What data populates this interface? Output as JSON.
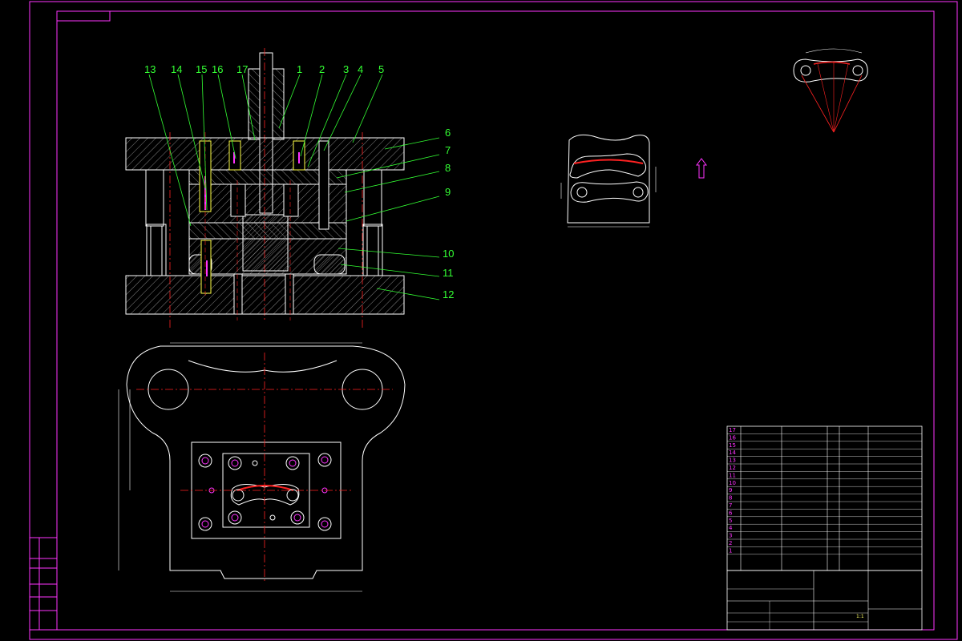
{
  "colors": {
    "background": "#000000",
    "frame": "#ff33ff",
    "outline": "#ffffff",
    "centerline": "#ff2222",
    "leader": "#33ff33",
    "hatch": "#cccccc",
    "dimension": "#ffffff",
    "bom_text": "#ff33ff",
    "bolt": "#ffff44"
  },
  "balloons": [
    "13",
    "14",
    "15",
    "16",
    "17",
    "1",
    "2",
    "3",
    "4",
    "5",
    "6",
    "7",
    "8",
    "9",
    "10",
    "11",
    "12"
  ],
  "side_labels": [
    "",
    "",
    "",
    "",
    "",
    ""
  ],
  "bom": {
    "rows": [
      {
        "no": "17",
        "name": "",
        "qty": "",
        "material": "",
        "note": ""
      },
      {
        "no": "16",
        "name": "",
        "qty": "",
        "material": "",
        "note": ""
      },
      {
        "no": "15",
        "name": "",
        "qty": "",
        "material": "",
        "note": ""
      },
      {
        "no": "14",
        "name": "",
        "qty": "",
        "material": "",
        "note": ""
      },
      {
        "no": "13",
        "name": "",
        "qty": "",
        "material": "",
        "note": ""
      },
      {
        "no": "12",
        "name": "",
        "qty": "",
        "material": "",
        "note": ""
      },
      {
        "no": "11",
        "name": "",
        "qty": "",
        "material": "",
        "note": ""
      },
      {
        "no": "10",
        "name": "",
        "qty": "",
        "material": "",
        "note": ""
      },
      {
        "no": "9",
        "name": "",
        "qty": "",
        "material": "",
        "note": ""
      },
      {
        "no": "8",
        "name": "",
        "qty": "",
        "material": "",
        "note": ""
      },
      {
        "no": "7",
        "name": "",
        "qty": "",
        "material": "",
        "note": ""
      },
      {
        "no": "6",
        "name": "",
        "qty": "",
        "material": "",
        "note": ""
      },
      {
        "no": "5",
        "name": "",
        "qty": "",
        "material": "",
        "note": ""
      },
      {
        "no": "4",
        "name": "",
        "qty": "",
        "material": "",
        "note": ""
      },
      {
        "no": "3",
        "name": "",
        "qty": "",
        "material": "",
        "note": ""
      },
      {
        "no": "2",
        "name": "",
        "qty": "",
        "material": "",
        "note": ""
      },
      {
        "no": "1",
        "name": "",
        "qty": "",
        "material": "",
        "note": ""
      }
    ],
    "scale": "1:1"
  }
}
